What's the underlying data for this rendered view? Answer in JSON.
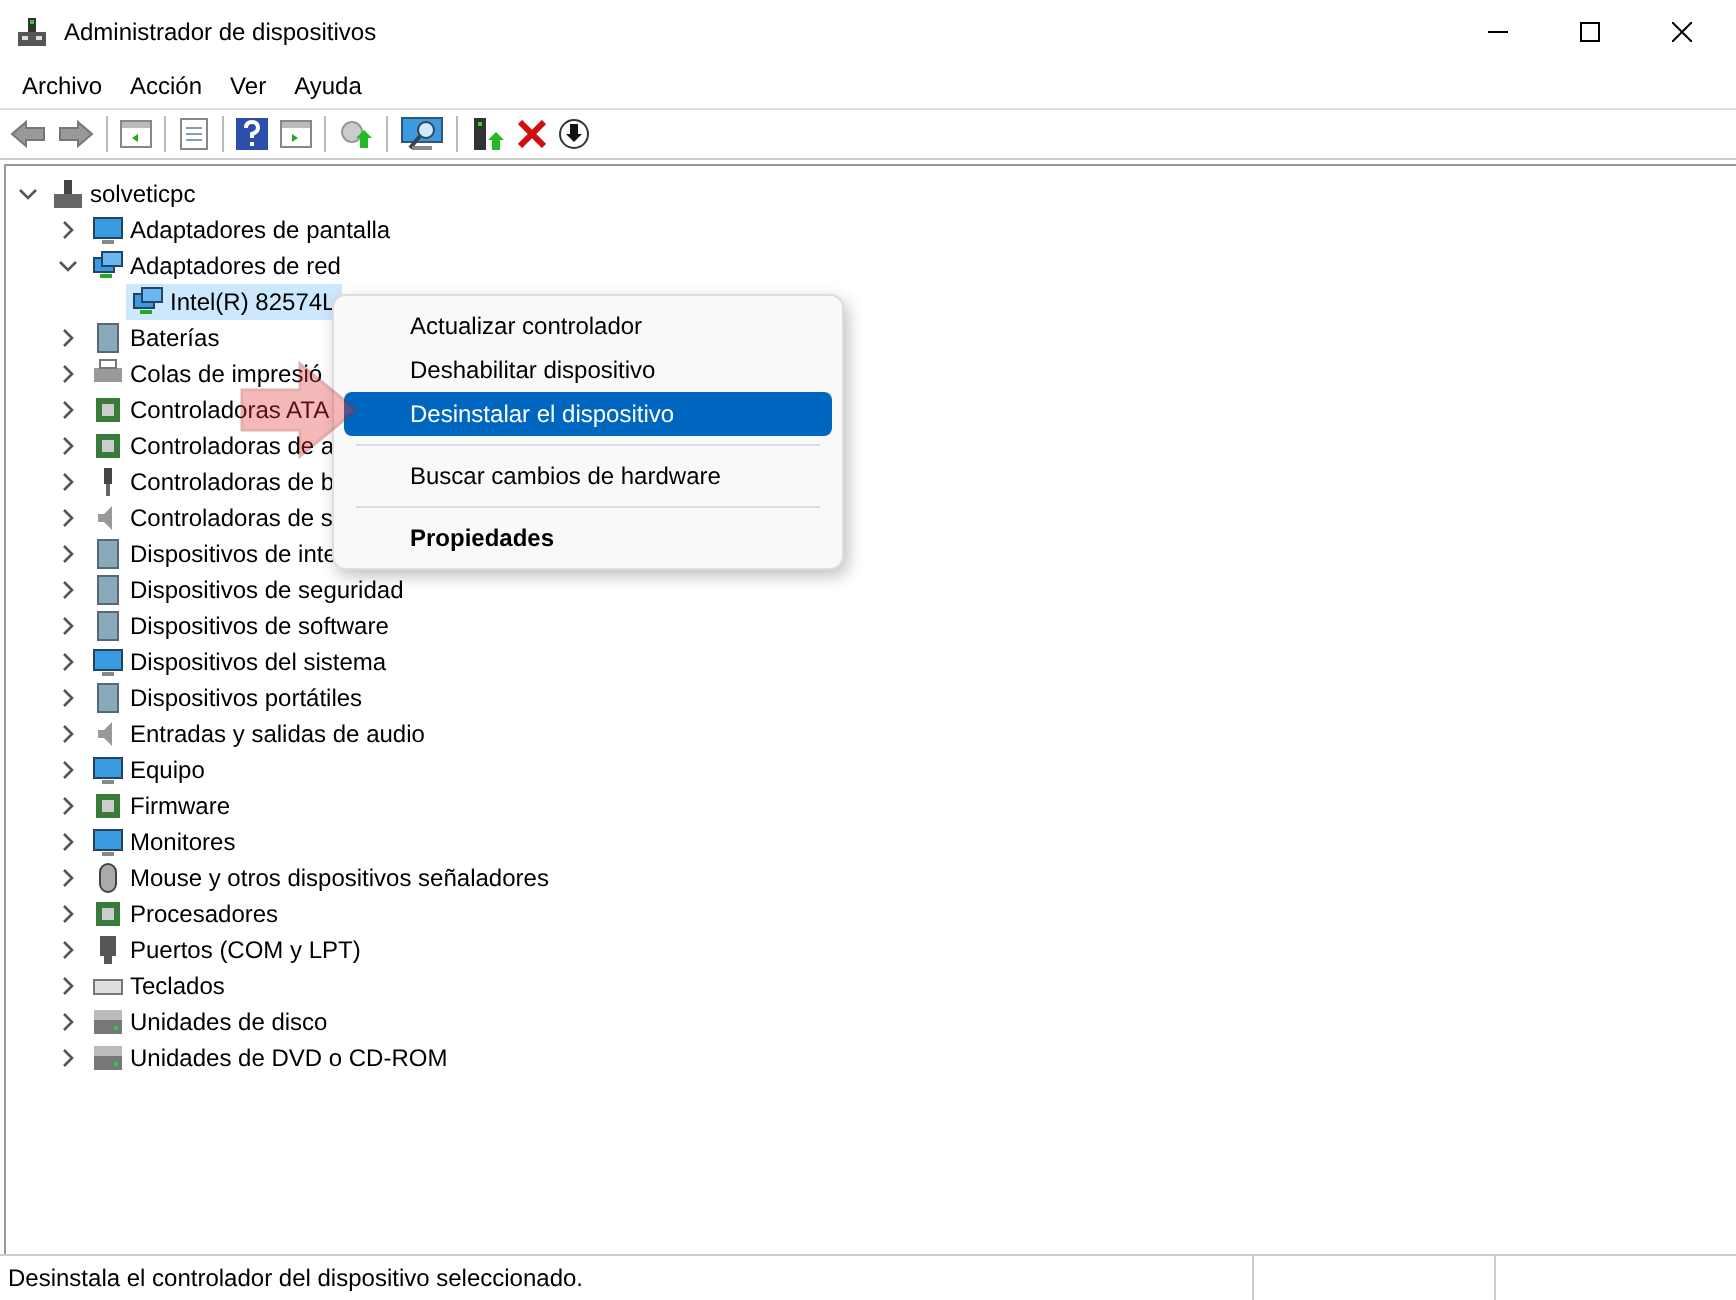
{
  "window": {
    "title": "Administrador de dispositivos"
  },
  "menu_bar": [
    "Archivo",
    "Acción",
    "Ver",
    "Ayuda"
  ],
  "tree": [
    {
      "label": "solveticpc",
      "expanded": true,
      "selected": false,
      "children": [
        {
          "label": "Adaptadores de pantalla",
          "expanded": false,
          "selected": false
        },
        {
          "label": "Adaptadores de red",
          "expanded": true,
          "selected": false,
          "children": [
            {
              "label": "Intel(R) 82574L",
              "selected": true
            }
          ]
        },
        {
          "label": "Baterías",
          "expanded": false,
          "selected": false
        },
        {
          "label": "Colas de impresió",
          "expanded": false,
          "selected": false
        },
        {
          "label": "Controladoras ATA",
          "expanded": false,
          "selected": false
        },
        {
          "label": "Controladoras de a",
          "expanded": false,
          "selected": false
        },
        {
          "label": "Controladoras de b",
          "expanded": false,
          "selected": false
        },
        {
          "label": "Controladoras de s",
          "expanded": false,
          "selected": false
        },
        {
          "label": "Dispositivos de inte",
          "expanded": false,
          "selected": false
        },
        {
          "label": "Dispositivos de seguridad",
          "expanded": false,
          "selected": false
        },
        {
          "label": "Dispositivos de software",
          "expanded": false,
          "selected": false
        },
        {
          "label": "Dispositivos del sistema",
          "expanded": false,
          "selected": false
        },
        {
          "label": "Dispositivos portátiles",
          "expanded": false,
          "selected": false
        },
        {
          "label": "Entradas y salidas de audio",
          "expanded": false,
          "selected": false
        },
        {
          "label": "Equipo",
          "expanded": false,
          "selected": false
        },
        {
          "label": "Firmware",
          "expanded": false,
          "selected": false
        },
        {
          "label": "Monitores",
          "expanded": false,
          "selected": false
        },
        {
          "label": "Mouse y otros dispositivos señaladores",
          "expanded": false,
          "selected": false
        },
        {
          "label": "Procesadores",
          "expanded": false,
          "selected": false
        },
        {
          "label": "Puertos (COM y LPT)",
          "expanded": false,
          "selected": false
        },
        {
          "label": "Teclados",
          "expanded": false,
          "selected": false
        },
        {
          "label": "Unidades de disco",
          "expanded": false,
          "selected": false
        },
        {
          "label": "Unidades de DVD o CD-ROM",
          "expanded": false,
          "selected": false
        }
      ]
    }
  ],
  "context_menu": [
    {
      "kind": "item",
      "label": "Actualizar controlador",
      "selected": false
    },
    {
      "kind": "item",
      "label": "Deshabilitar dispositivo",
      "selected": false
    },
    {
      "kind": "item",
      "label": "Desinstalar el dispositivo",
      "selected": true
    },
    {
      "kind": "separator"
    },
    {
      "kind": "item",
      "label": "Buscar cambios de hardware",
      "selected": false
    },
    {
      "kind": "separator"
    },
    {
      "kind": "default",
      "label": "Propiedades",
      "selected": false
    }
  ],
  "status_bar": {
    "text": "Desinstala el controlador del dispositivo seleccionado."
  }
}
